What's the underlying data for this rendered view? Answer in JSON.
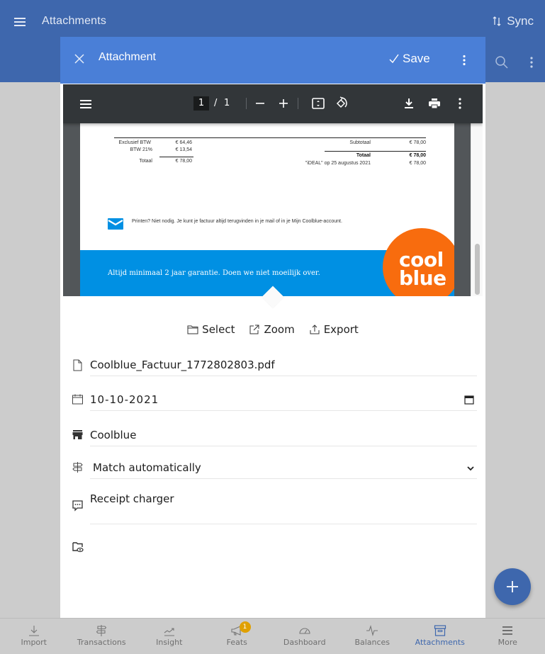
{
  "app_bar": {
    "title": "Attachments",
    "sync_label": "Sync",
    "sync_icon": "sort-arrows-icon",
    "menu_icon": "hamburger-icon",
    "search_icon": "search-icon",
    "more_icon": "kebab-icon"
  },
  "dialog": {
    "title": "Attachment",
    "save_label": "Save",
    "close_icon": "close-icon",
    "save_icon": "check-icon",
    "more_icon": "kebab-icon"
  },
  "pdf_viewer": {
    "current_page": "1",
    "separator": "/",
    "total_pages": "1",
    "toolbar_icons": [
      "menu-icon",
      "zoom-out-icon",
      "zoom-in-icon",
      "fit-page-icon",
      "rotate-icon",
      "download-icon",
      "print-icon",
      "more-icon"
    ],
    "document": {
      "left_table": [
        {
          "label": "Exclusief BTW",
          "value": "€ 64,46"
        },
        {
          "label": "BTW 21%",
          "value": "€ 13,54"
        },
        {
          "label": "Totaal",
          "value": "€ 78,00"
        }
      ],
      "right_table": [
        {
          "label": "Subtotaal",
          "value": "€ 78,00"
        },
        {
          "label": "Totaal",
          "value": "€ 78,00"
        },
        {
          "label": "\"iDEAL\" op 25 augustus 2021",
          "value": "€ 78,00"
        }
      ],
      "print_note": "Printen? Niet nodig. Je kunt je factuur altijd terugvinden in je mail of in je Mijn Coolblue-account.",
      "banner_text": "Altijd minimaal 2 jaar garantie. Doen we niet moeilijk over.",
      "logo_line1": "cool",
      "logo_line2": "blue",
      "brand_blue": "#0090e3",
      "brand_orange": "#f86c0e"
    }
  },
  "actions": {
    "select_label": "Select",
    "zoom_label": "Zoom",
    "export_label": "Export"
  },
  "form": {
    "filename": "Coolblue_Factuur_1772802803.pdf",
    "date": "10-10-2021",
    "payee": "Coolblue",
    "match_mode": "Match automatically",
    "note": "Receipt charger",
    "folder": ""
  },
  "bottom_nav": {
    "items": [
      {
        "label": "Import",
        "icon": "download-arrow-icon"
      },
      {
        "label": "Transactions",
        "icon": "signpost-icon"
      },
      {
        "label": "Insight",
        "icon": "trend-icon"
      },
      {
        "label": "Feats",
        "icon": "megaphone-icon",
        "badge": "1"
      },
      {
        "label": "Dashboard",
        "icon": "gauge-icon"
      },
      {
        "label": "Balances",
        "icon": "pulse-icon"
      },
      {
        "label": "Attachments",
        "icon": "archive-icon",
        "active": true
      },
      {
        "label": "More",
        "icon": "hamburger-icon"
      }
    ]
  },
  "colors": {
    "primary": "#3e67ad",
    "dialog_header": "#4a7fd7",
    "badge": "#e0a000"
  }
}
